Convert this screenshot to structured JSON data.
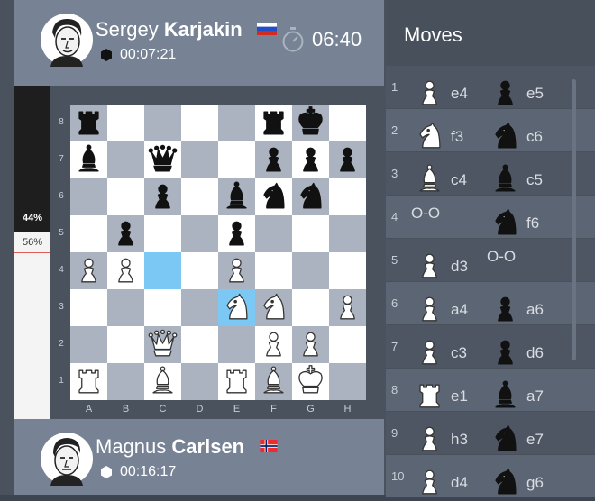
{
  "top_player": {
    "first_name": "Sergey",
    "last_name": "Karjakin",
    "flag": "russia-flag",
    "total_time": "00:07:21",
    "clock": "06:40"
  },
  "bottom_player": {
    "first_name": "Magnus",
    "last_name": "Carlsen",
    "flag": "norway-flag",
    "total_time": "00:16:17"
  },
  "evaluation": {
    "black_percent": "44%",
    "white_percent": "56%",
    "black_fraction": 0.44
  },
  "board": {
    "rank_labels": [
      "8",
      "7",
      "6",
      "5",
      "4",
      "3",
      "2",
      "1"
    ],
    "file_labels": [
      "A",
      "B",
      "C",
      "D",
      "E",
      "F",
      "G",
      "H"
    ],
    "highlighted_squares": [
      "c4",
      "e3"
    ],
    "pieces": [
      {
        "sq": "a8",
        "p": "r",
        "c": "b"
      },
      {
        "sq": "f8",
        "p": "r",
        "c": "b"
      },
      {
        "sq": "g8",
        "p": "k",
        "c": "b"
      },
      {
        "sq": "a7",
        "p": "b",
        "c": "b"
      },
      {
        "sq": "c7",
        "p": "q",
        "c": "b"
      },
      {
        "sq": "f7",
        "p": "p",
        "c": "b"
      },
      {
        "sq": "g7",
        "p": "p",
        "c": "b"
      },
      {
        "sq": "h7",
        "p": "p",
        "c": "b"
      },
      {
        "sq": "c6",
        "p": "p",
        "c": "b"
      },
      {
        "sq": "e6",
        "p": "b",
        "c": "b"
      },
      {
        "sq": "f6",
        "p": "n",
        "c": "b"
      },
      {
        "sq": "g6",
        "p": "n",
        "c": "b"
      },
      {
        "sq": "b5",
        "p": "p",
        "c": "b"
      },
      {
        "sq": "e5",
        "p": "p",
        "c": "b"
      },
      {
        "sq": "a4",
        "p": "p",
        "c": "w"
      },
      {
        "sq": "b4",
        "p": "p",
        "c": "w"
      },
      {
        "sq": "e4",
        "p": "p",
        "c": "w"
      },
      {
        "sq": "e3",
        "p": "n",
        "c": "w"
      },
      {
        "sq": "f3",
        "p": "n",
        "c": "w"
      },
      {
        "sq": "h3",
        "p": "p",
        "c": "w"
      },
      {
        "sq": "c2",
        "p": "q",
        "c": "w"
      },
      {
        "sq": "f2",
        "p": "p",
        "c": "w"
      },
      {
        "sq": "g2",
        "p": "p",
        "c": "w"
      },
      {
        "sq": "a1",
        "p": "r",
        "c": "w"
      },
      {
        "sq": "c1",
        "p": "b",
        "c": "w"
      },
      {
        "sq": "e1",
        "p": "r",
        "c": "w"
      },
      {
        "sq": "f1",
        "p": "b",
        "c": "w"
      },
      {
        "sq": "g1",
        "p": "k",
        "c": "w"
      }
    ]
  },
  "moves": {
    "title": "Moves",
    "list": [
      {
        "num": "1",
        "white_piece": "p",
        "white": "e4",
        "black_piece": "p",
        "black": "e5"
      },
      {
        "num": "2",
        "white_piece": "n",
        "white": "f3",
        "black_piece": "n",
        "black": "c6"
      },
      {
        "num": "3",
        "white_piece": "b",
        "white": "c4",
        "black_piece": "b",
        "black": "c5"
      },
      {
        "num": "4",
        "white_piece": "",
        "white": "O-O",
        "black_piece": "n",
        "black": "f6"
      },
      {
        "num": "5",
        "white_piece": "p",
        "white": "d3",
        "black_piece": "",
        "black": "O-O"
      },
      {
        "num": "6",
        "white_piece": "p",
        "white": "a4",
        "black_piece": "p",
        "black": "a6"
      },
      {
        "num": "7",
        "white_piece": "p",
        "white": "c3",
        "black_piece": "p",
        "black": "d6"
      },
      {
        "num": "8",
        "white_piece": "r",
        "white": "e1",
        "black_piece": "b",
        "black": "a7"
      },
      {
        "num": "9",
        "white_piece": "p",
        "white": "h3",
        "black_piece": "n",
        "black": "e7"
      },
      {
        "num": "10",
        "white_piece": "p",
        "white": "d4",
        "black_piece": "n",
        "black": "g6"
      }
    ]
  }
}
